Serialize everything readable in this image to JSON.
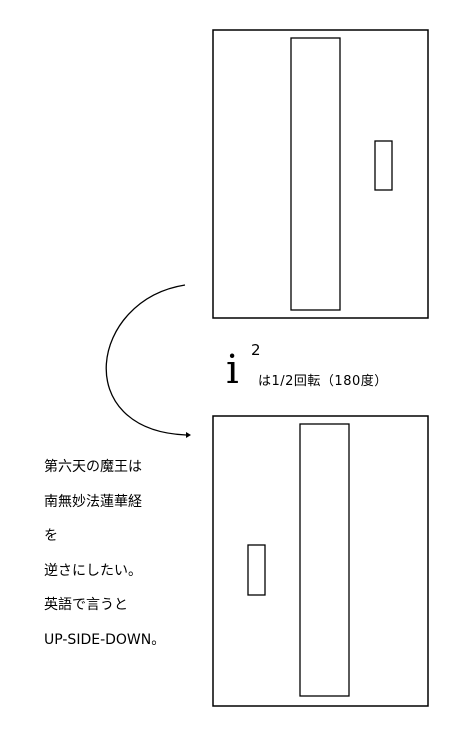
{
  "equation": {
    "base": "i",
    "exponent": "2",
    "note": "は1/2回転（180度）"
  },
  "text_lines": [
    "第六天の魔王は",
    "南無妙法蓮華経",
    "を",
    "逆さにしたい。",
    "英語で言うと",
    "UP-SIDE-DOWN。"
  ]
}
